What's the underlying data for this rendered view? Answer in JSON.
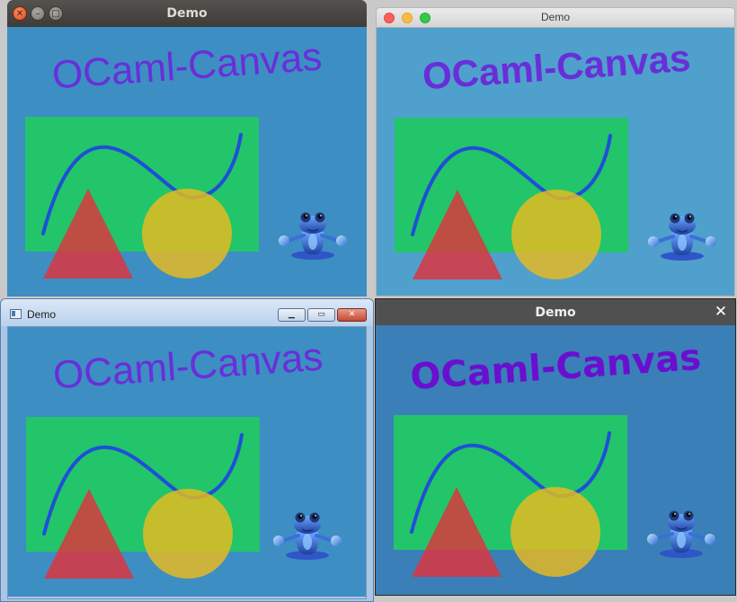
{
  "app": {
    "window_title": "Demo",
    "canvas_text": "OCaml-Canvas"
  },
  "controls": {
    "close_glyph": "✕",
    "min_glyph": "–",
    "max_glyph": "□",
    "win_min_glyph": "▁",
    "win_max_glyph": "▭",
    "win_close_glyph": "✕",
    "flat_close_glyph": "✕"
  },
  "colors": {
    "canvas_bg": "#3d8ec3",
    "canvas_bg_mac": "#4fa0cc",
    "canvas_bg_dark": "#3a7fb8",
    "rect_green": "#22c56a",
    "curve_blue": "#1f4fd8",
    "triangle_red": "#e0323c",
    "circle_yellow": "#eabb1e",
    "text_violet": "#6a2ed9",
    "text_violet_bold": "#6a0fd0"
  },
  "icons": {
    "frog": "frog-sprite-icon"
  }
}
